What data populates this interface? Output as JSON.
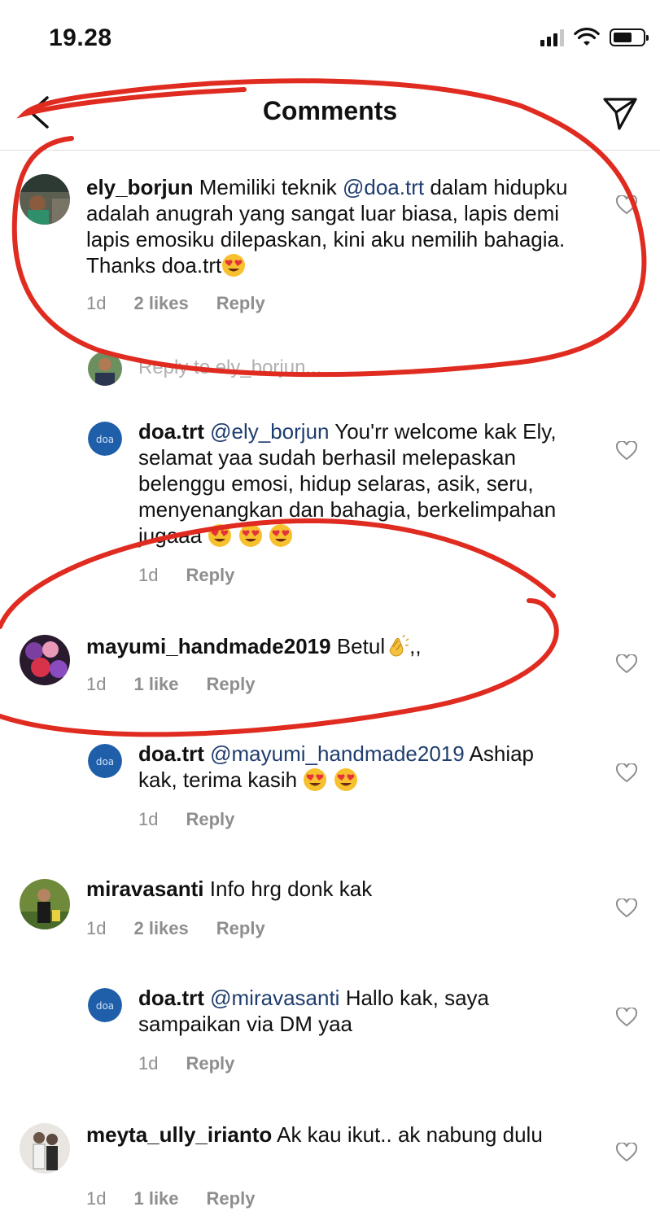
{
  "status_bar": {
    "time": "19.28",
    "signal_bars": 4,
    "signal_bars_active": 3,
    "battery_level": 0.55
  },
  "header": {
    "title": "Comments",
    "back_icon": "chevron-left-icon",
    "send_icon": "paper-plane-icon"
  },
  "colors": {
    "mention": "#1f3d6e",
    "meta": "#8e8e8e",
    "annotation": "#e02b20",
    "divider": "#dbdbdb"
  },
  "comments": [
    {
      "user": "ely_borjun",
      "mention": "@doa.trt",
      "text_before": "Memiliki teknik",
      "text_after": "dalam hidupku adalah anugrah yang sangat luar biasa, lapis demi lapis emosiku dilepaskan, kini aku nemilih bahagia. Thanks doa.trt",
      "emoji": "heart-eyes-emoji",
      "time": "1d",
      "likes": "2 likes",
      "reply": "Reply"
    },
    {
      "reply_placeholder": "Reply to ely_borjun..."
    },
    {
      "user": "doa.trt",
      "mention": "@ely_borjun",
      "text": "You'rr welcome kak Ely, selamat yaa sudah berhasil melepaskan belenggu emosi, hidup selaras, asik, seru, menyenangkan dan bahagia, berkelimpahan jugaaa",
      "emoji_count": 3,
      "time": "1d",
      "reply": "Reply"
    },
    {
      "user": "mayumi_handmade2019",
      "text": "Betul",
      "text_suffix": ",,",
      "emoji": "clapping-hands-emoji",
      "time": "1d",
      "likes": "1 like",
      "reply": "Reply"
    },
    {
      "user": "doa.trt",
      "mention": "@mayumi_handmade2019",
      "text": "Ashiap kak, terima kasih",
      "emoji_count": 2,
      "time": "1d",
      "reply": "Reply"
    },
    {
      "user": "miravasanti",
      "text": "Info hrg donk kak",
      "time": "1d",
      "likes": "2 likes",
      "reply": "Reply"
    },
    {
      "user": "doa.trt",
      "mention": "@miravasanti",
      "text": "Hallo kak, saya sampaikan via DM yaa",
      "time": "1d",
      "reply": "Reply"
    },
    {
      "user": "meyta_ully_irianto",
      "text": "Ak kau ikut.. ak nabung dulu",
      "time": "1d",
      "likes": "1 like",
      "reply": "Reply"
    }
  ]
}
